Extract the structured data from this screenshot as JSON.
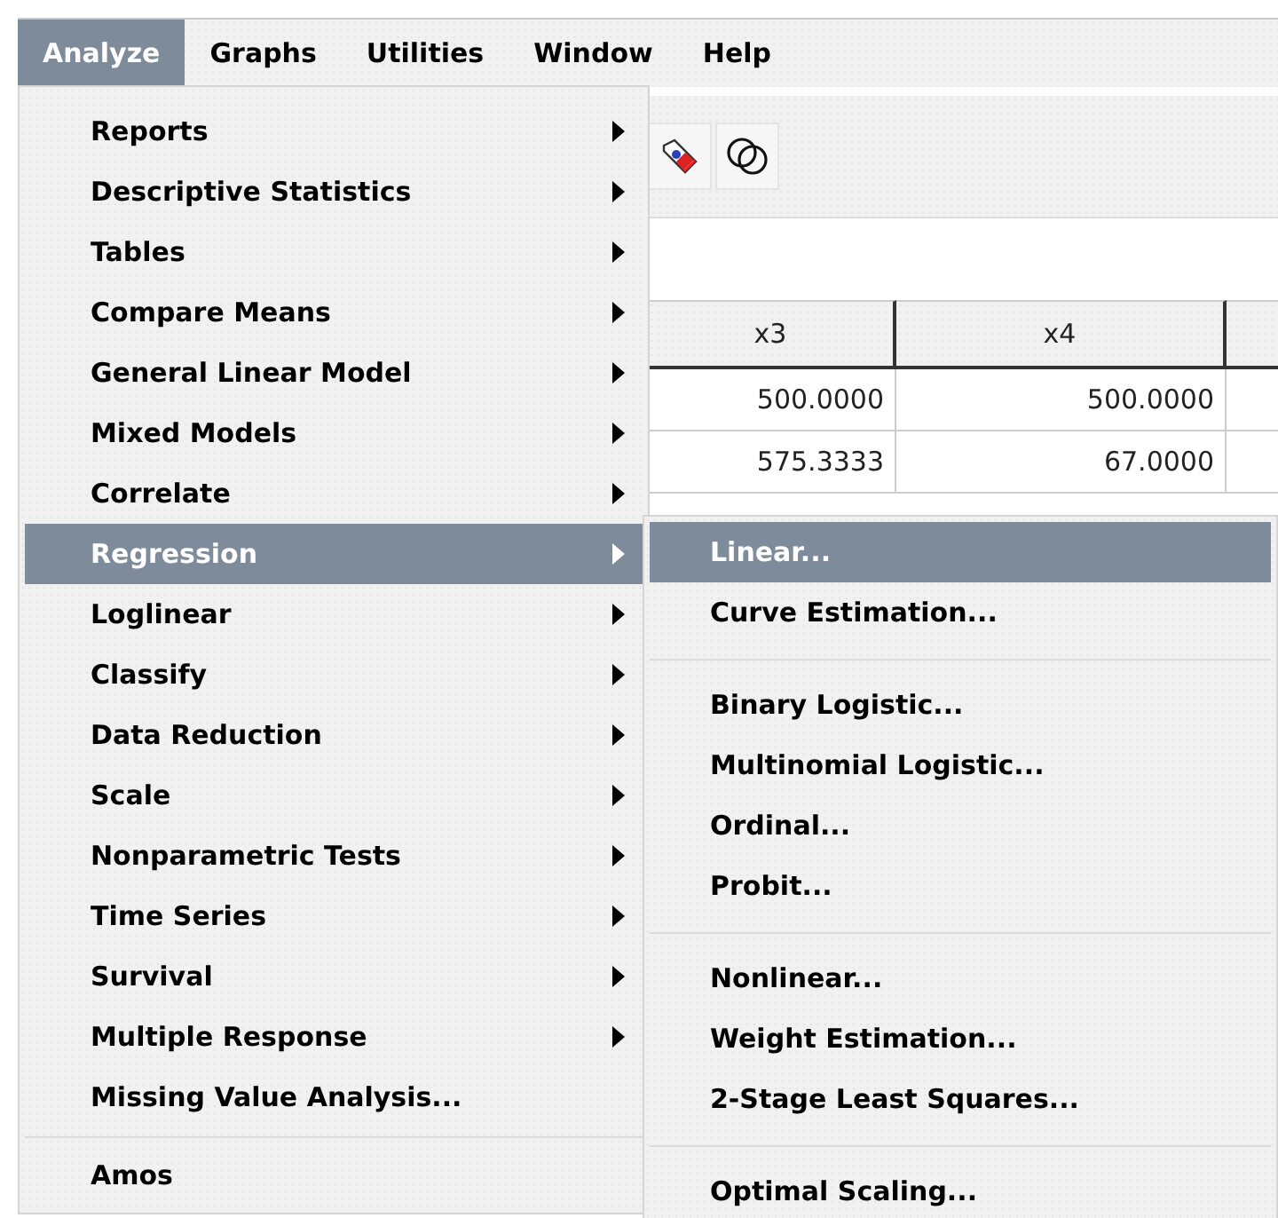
{
  "menubar": [
    {
      "label": "Analyze",
      "selected": true
    },
    {
      "label": "Graphs",
      "selected": false
    },
    {
      "label": "Utilities",
      "selected": false
    },
    {
      "label": "Window",
      "selected": false
    },
    {
      "label": "Help",
      "selected": false
    }
  ],
  "table": {
    "columns": [
      "x3",
      "x4"
    ],
    "rows": [
      [
        "500.0000",
        "500.0000"
      ],
      [
        "575.3333",
        "67.0000"
      ]
    ]
  },
  "menu": [
    {
      "kind": "submenu",
      "label": "Reports",
      "selected": false
    },
    {
      "kind": "submenu",
      "label": "Descriptive Statistics",
      "selected": false
    },
    {
      "kind": "submenu",
      "label": "Tables",
      "selected": false
    },
    {
      "kind": "submenu",
      "label": "Compare Means",
      "selected": false
    },
    {
      "kind": "submenu",
      "label": "General Linear Model",
      "selected": false
    },
    {
      "kind": "submenu",
      "label": "Mixed Models",
      "selected": false
    },
    {
      "kind": "submenu",
      "label": "Correlate",
      "selected": false
    },
    {
      "kind": "submenu",
      "label": "Regression",
      "selected": true
    },
    {
      "kind": "submenu",
      "label": "Loglinear",
      "selected": false
    },
    {
      "kind": "submenu",
      "label": "Classify",
      "selected": false
    },
    {
      "kind": "submenu",
      "label": "Data Reduction",
      "selected": false
    },
    {
      "kind": "submenu",
      "label": "Scale",
      "selected": false
    },
    {
      "kind": "submenu",
      "label": "Nonparametric Tests",
      "selected": false
    },
    {
      "kind": "submenu",
      "label": "Time Series",
      "selected": false
    },
    {
      "kind": "submenu",
      "label": "Survival",
      "selected": false
    },
    {
      "kind": "submenu",
      "label": "Multiple Response",
      "selected": false
    },
    {
      "kind": "command",
      "label": "Missing Value Analysis...",
      "selected": false
    },
    {
      "kind": "separator"
    },
    {
      "kind": "command",
      "label": "Amos",
      "selected": false
    }
  ],
  "submenu": [
    {
      "kind": "command",
      "label": "Linear...",
      "selected": true
    },
    {
      "kind": "command",
      "label": "Curve Estimation...",
      "selected": false
    },
    {
      "kind": "separator"
    },
    {
      "kind": "command",
      "label": "Binary Logistic...",
      "selected": false
    },
    {
      "kind": "command",
      "label": "Multinomial Logistic...",
      "selected": false
    },
    {
      "kind": "command",
      "label": "Ordinal...",
      "selected": false
    },
    {
      "kind": "command",
      "label": "Probit...",
      "selected": false
    },
    {
      "kind": "separator"
    },
    {
      "kind": "command",
      "label": "Nonlinear...",
      "selected": false
    },
    {
      "kind": "command",
      "label": "Weight Estimation...",
      "selected": false
    },
    {
      "kind": "command",
      "label": "2-Stage Least Squares...",
      "selected": false
    },
    {
      "kind": "separator"
    },
    {
      "kind": "command",
      "label": "Optimal Scaling...",
      "selected": false
    }
  ]
}
